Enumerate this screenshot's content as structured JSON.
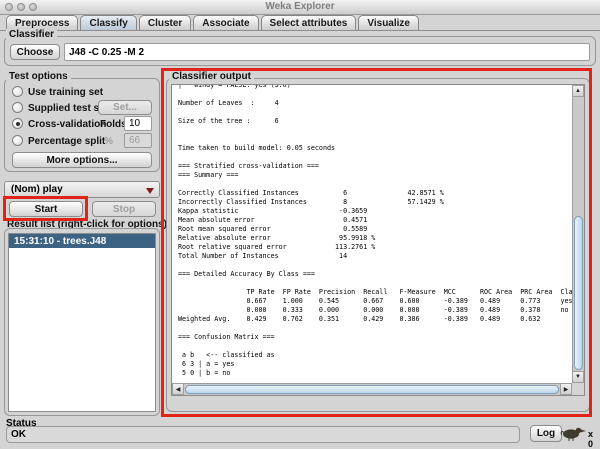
{
  "window": {
    "title": "Weka Explorer"
  },
  "tabs": [
    {
      "label": "Preprocess",
      "selected": false
    },
    {
      "label": "Classify",
      "selected": true
    },
    {
      "label": "Cluster",
      "selected": false
    },
    {
      "label": "Associate",
      "selected": false
    },
    {
      "label": "Select attributes",
      "selected": false
    },
    {
      "label": "Visualize",
      "selected": false
    }
  ],
  "classifier": {
    "section_title": "Classifier",
    "choose_button": "Choose",
    "scheme": "J48 -C 0.25 -M 2"
  },
  "test_options": {
    "title": "Test options",
    "use_training_set": "Use training set",
    "supplied_test_set": "Supplied test set",
    "set_button": "Set...",
    "cross_validation": "Cross-validation",
    "folds_label": "Folds",
    "folds_value": "10",
    "percentage_split": "Percentage split",
    "percent_label": "%",
    "percent_value": "66",
    "more_options_button": "More options...",
    "selected_option": "Cross-validation"
  },
  "class_selector": {
    "value": "(Nom) play"
  },
  "actions": {
    "start_button": "Start",
    "stop_button": "Stop"
  },
  "result_list": {
    "title": "Result list (right-click for options)",
    "items": [
      {
        "label": "15:31:10 - trees.J48",
        "selected": true
      }
    ]
  },
  "classifier_output": {
    "title": "Classifier output",
    "text": "|   windy = FALSE: yes (3.0)\n\nNumber of Leaves  :     4\n\nSize of the tree :      6\n\n\nTime taken to build model: 0.05 seconds\n\n=== Stratified cross-validation ===\n=== Summary ===\n\nCorrectly Classified Instances           6               42.8571 %\nIncorrectly Classified Instances         8               57.1429 %\nKappa statistic                         -0.3659\nMean absolute error                      0.4571\nRoot mean squared error                  0.5589\nRelative absolute error                 95.9918 %\nRoot relative squared error            113.2761 %\nTotal Number of Instances               14     \n\n=== Detailed Accuracy By Class ===\n\n                 TP Rate  FP Rate  Precision  Recall   F-Measure  MCC      ROC Area  PRC Area  Class\n                 0.667    1.000    0.545      0.667    0.600      -0.389   0.489     0.773     yes\n                 0.000    0.333    0.000      0.000    0.000      -0.389   0.489     0.378     no\nWeighted Avg.    0.429    0.762    0.351      0.429    0.386      -0.389   0.489     0.632     \n\n=== Confusion Matrix ===\n\n a b   <-- classified as\n 6 3 | a = yes\n 5 0 | b = no\n"
  },
  "status_bar": {
    "title": "Status",
    "message": "OK",
    "log_button": "Log",
    "bird_counter": "x 0"
  },
  "annotation": {
    "color": "#e2231a"
  },
  "colors": {
    "selection_blue": "#3c6384",
    "annotation_red": "#e2231a",
    "scrollbar_thumb": "#bcd6ea",
    "window_background": "#d4d4d4"
  }
}
